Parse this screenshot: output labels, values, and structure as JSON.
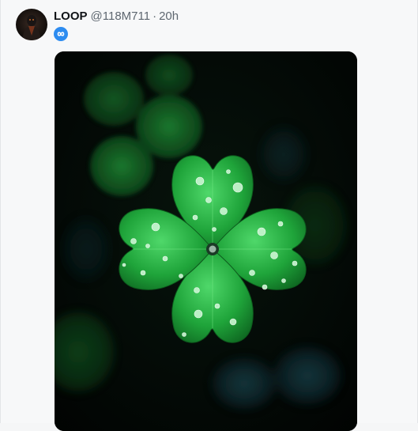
{
  "post": {
    "author_name": "LOOP",
    "author_handle": "@118M711",
    "separator": "·",
    "timestamp": "20h",
    "badge_icon": "infinity-icon",
    "media_icon": "four-leaf-clover-photo",
    "accent_color": "#2d8cf0"
  }
}
